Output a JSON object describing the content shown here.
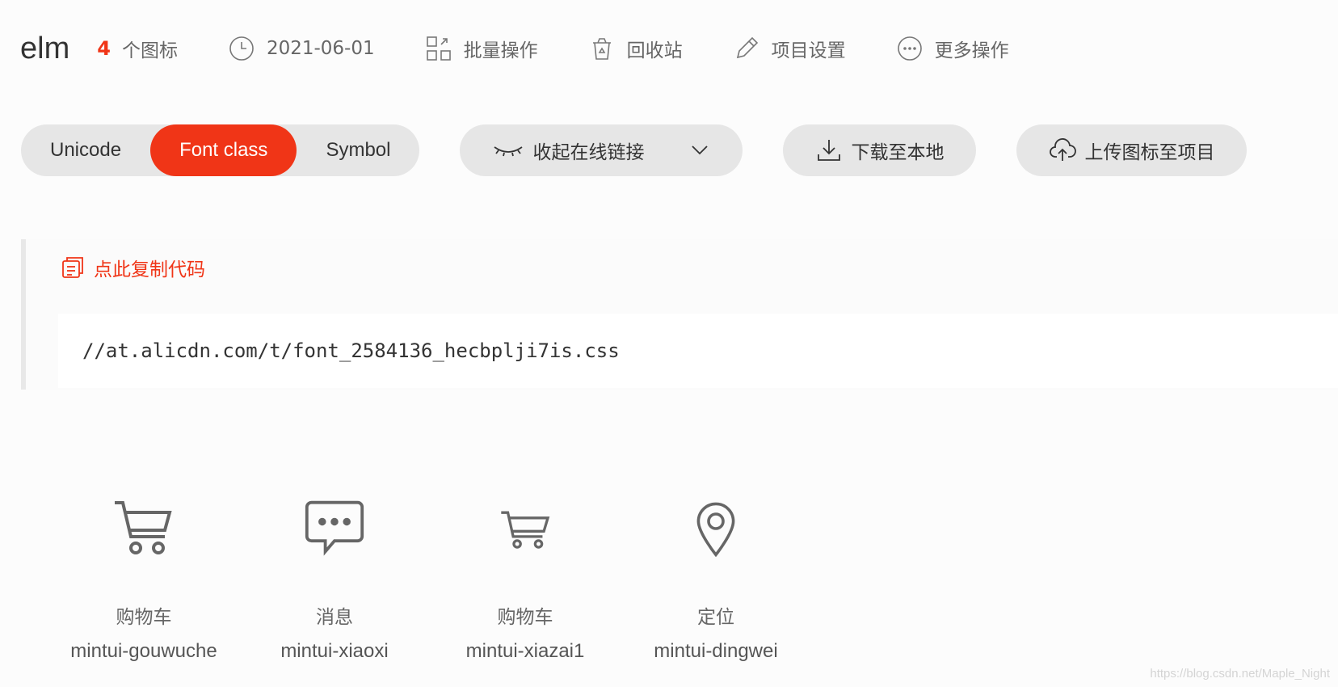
{
  "header": {
    "project_name": "elm",
    "icon_count": "4",
    "icon_count_label": "个图标",
    "date": "2021-06-01",
    "batch_label": "批量操作",
    "recycle_label": "回收站",
    "settings_label": "项目设置",
    "more_label": "更多操作"
  },
  "toolbar": {
    "tabs": [
      {
        "label": "Unicode",
        "active": false
      },
      {
        "label": "Font class",
        "active": true
      },
      {
        "label": "Symbol",
        "active": false
      }
    ],
    "collapse_link_label": "收起在线链接",
    "download_label": "下载至本地",
    "upload_label": "上传图标至项目"
  },
  "code_panel": {
    "copy_label": "点此复制代码",
    "code": "//at.alicdn.com/t/font_2584136_hecbplji7is.css"
  },
  "icons": [
    {
      "name": "购物车",
      "code": "mintui-gouwuche",
      "icon": "shopping-cart-icon"
    },
    {
      "name": "消息",
      "code": "mintui-xiaoxi",
      "icon": "message-icon"
    },
    {
      "name": "购物车",
      "code": "mintui-xiazai1",
      "icon": "shopping-cart-small-icon"
    },
    {
      "name": "定位",
      "code": "mintui-dingwei",
      "icon": "location-pin-icon"
    }
  ],
  "watermark": "https://blog.csdn.net/Maple_Night",
  "colors": {
    "accent": "#f03517",
    "pill_bg": "#e6e6e6",
    "text_muted": "#666666"
  }
}
